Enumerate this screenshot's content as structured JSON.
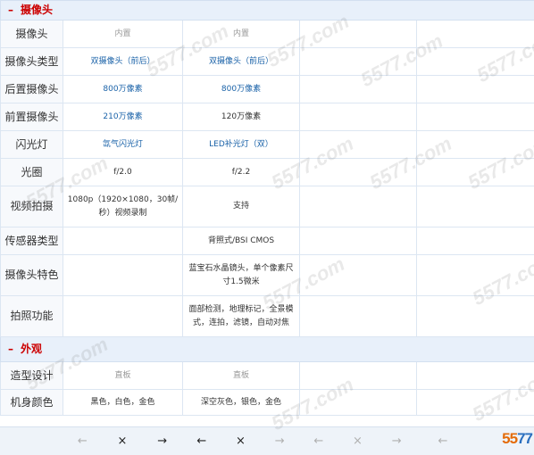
{
  "sections": {
    "camera": {
      "title": "摄像头",
      "toggle": "–"
    },
    "appearance": {
      "title": "外观",
      "toggle": "–"
    }
  },
  "rows": {
    "camera": {
      "label": "摄像头",
      "c1": "内置",
      "c2": "内置"
    },
    "camera_type": {
      "label": "摄像头类型",
      "c1": "双摄像头（前后）",
      "c2": "双摄像头（前后）"
    },
    "rear_camera": {
      "label": "后置摄像头",
      "c1": "800万像素",
      "c2": "800万像素"
    },
    "front_camera": {
      "label": "前置摄像头",
      "c1": "210万像素",
      "c2": "120万像素"
    },
    "flash": {
      "label": "闪光灯",
      "c1": "氙气闪光灯",
      "c2": "LED补光灯（双）"
    },
    "aperture": {
      "label": "光圈",
      "c1": "f/2.0",
      "c2": "f/2.2"
    },
    "video": {
      "label": "视频拍摄",
      "c1": "1080p（1920×1080，30帧/秒）视频录制",
      "c2": "支持"
    },
    "sensor": {
      "label": "传感器类型",
      "c1": "",
      "c2": "背照式/BSI CMOS"
    },
    "camera_features": {
      "label": "摄像头特色",
      "c1": "",
      "c2": "蓝宝石水晶镜头，单个像素尺寸1.5微米"
    },
    "photo_functions": {
      "label": "拍照功能",
      "c1": "",
      "c2": "面部检测，地理标记，全景模式，连拍，滤镜，自动对焦"
    },
    "design": {
      "label": "造型设计",
      "c1": "直板",
      "c2": "直板"
    },
    "body_color": {
      "label": "机身颜色",
      "c1": "黑色，白色，金色",
      "c2": "深空灰色，银色，金色"
    }
  },
  "controls": {
    "left": "←",
    "remove": "×",
    "right": "→"
  },
  "watermark": "5577.com",
  "logo": {
    "part1": "55",
    "part2": "77"
  }
}
